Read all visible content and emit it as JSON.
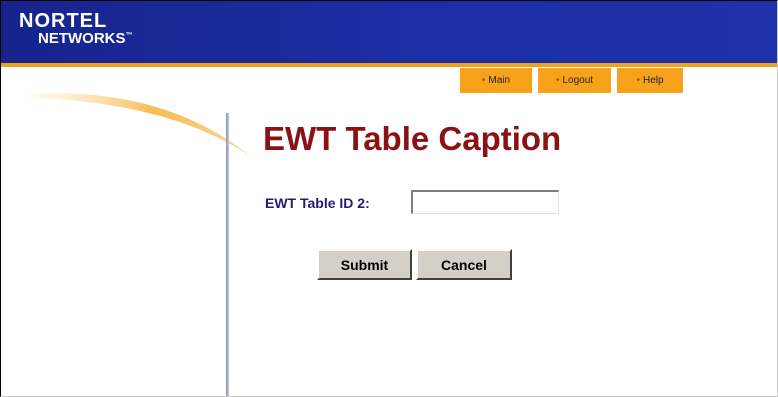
{
  "brand": {
    "line1": "NORTEL",
    "line2": "NETWORKS",
    "trademark": "™"
  },
  "nav": {
    "items": [
      {
        "label": "Main"
      },
      {
        "label": "Logout"
      },
      {
        "label": "Help"
      }
    ]
  },
  "page": {
    "title": "EWT Table Caption"
  },
  "form": {
    "field_label": "EWT Table ID 2:",
    "field_value": "",
    "submit_label": "Submit",
    "cancel_label": "Cancel"
  },
  "colors": {
    "header_blue": "#1c2fa6",
    "accent_orange": "#f7a21b",
    "title_red": "#8b1212",
    "label_purple": "#2a1a6e"
  }
}
